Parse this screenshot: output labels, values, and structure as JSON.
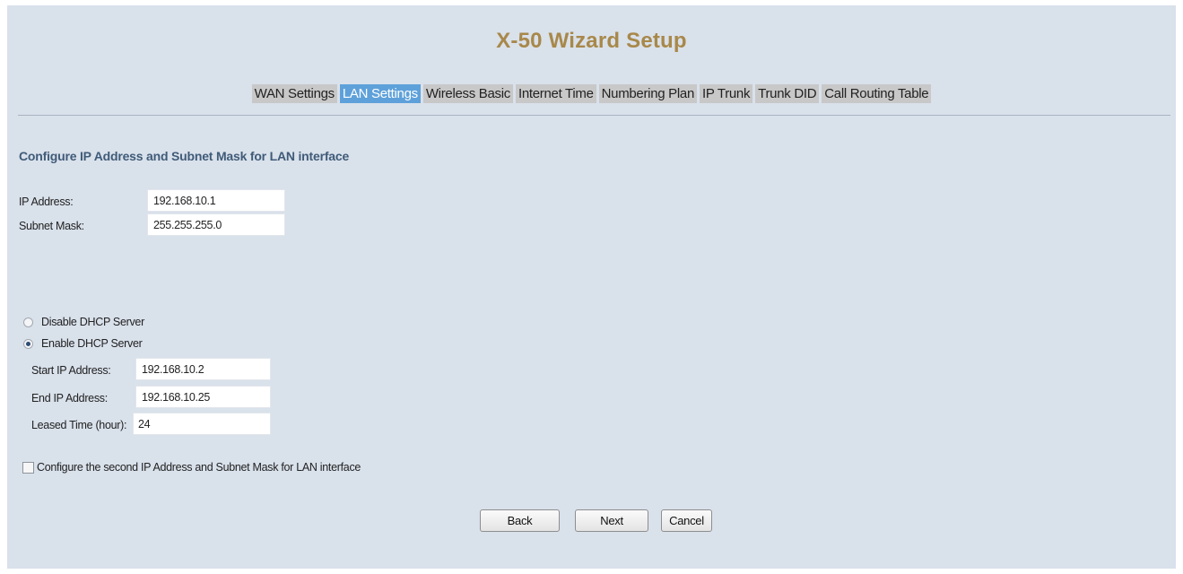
{
  "title": "X-50 Wizard Setup",
  "tabs": [
    {
      "label": "WAN Settings",
      "active": false
    },
    {
      "label": "LAN Settings",
      "active": true
    },
    {
      "label": "Wireless Basic",
      "active": false
    },
    {
      "label": "Internet Time",
      "active": false
    },
    {
      "label": "Numbering Plan",
      "active": false
    },
    {
      "label": "IP Trunk",
      "active": false
    },
    {
      "label": "Trunk DID",
      "active": false
    },
    {
      "label": "Call Routing Table",
      "active": false
    }
  ],
  "section_title": "Configure IP Address and Subnet Mask for LAN interface",
  "lan": {
    "ip_label": "IP Address:",
    "ip_value": "192.168.10.1",
    "mask_label": "Subnet Mask:",
    "mask_value": "255.255.255.0"
  },
  "dhcp": {
    "disable_label": "Disable DHCP Server",
    "enable_label": "Enable DHCP Server",
    "selected": "enable",
    "start_label": "Start IP Address:",
    "start_value": "192.168.10.2",
    "end_label": "End IP Address:",
    "end_value": "192.168.10.25",
    "lease_label": "Leased Time (hour):",
    "lease_value": "24"
  },
  "second_ip": {
    "label": "Configure the second IP Address and Subnet Mask for LAN interface",
    "checked": false
  },
  "buttons": {
    "back": "Back",
    "next": "Next",
    "cancel": "Cancel"
  },
  "colors": {
    "background": "#d9e1eb",
    "title": "#a8884a",
    "active_tab": "#5ea1da",
    "inactive_tab": "#c8c8c8",
    "section_title": "#3f5b78"
  }
}
